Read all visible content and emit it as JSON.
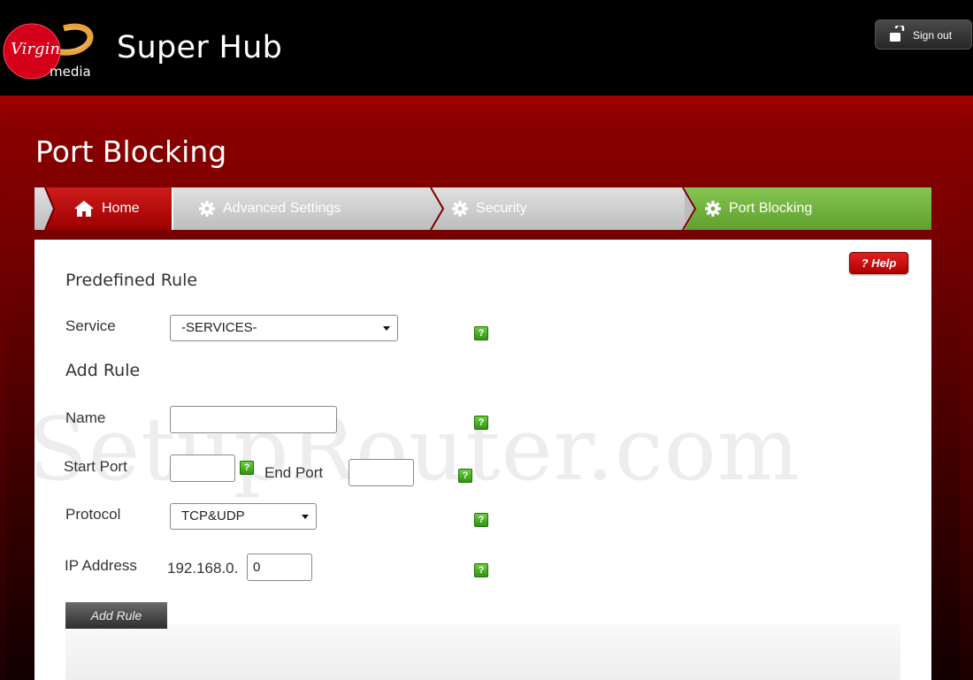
{
  "header": {
    "logo_text": "Virgin media",
    "app_title": "Super Hub",
    "signout_label": "Sign out"
  },
  "page": {
    "title": "Port Blocking",
    "help_label": "? Help"
  },
  "breadcrumb": [
    {
      "label": "Home",
      "icon": "home-icon"
    },
    {
      "label": "Advanced Settings",
      "icon": "gear-icon"
    },
    {
      "label": "Security",
      "icon": "gear-icon"
    },
    {
      "label": "Port Blocking",
      "icon": "gear-icon"
    }
  ],
  "predefined_rule": {
    "title": "Predefined Rule",
    "service_label": "Service",
    "service_value": "-SERVICES-"
  },
  "add_rule": {
    "title": "Add Rule",
    "name_label": "Name",
    "name_value": "",
    "start_port_label": "Start Port",
    "start_port_value": "",
    "end_port_label": "End Port",
    "end_port_value": "",
    "protocol_label": "Protocol",
    "protocol_value": "TCP&UDP",
    "ip_label": "IP Address",
    "ip_prefix": "192.168.0.",
    "ip_last_octet": "0",
    "button_label": "Add Rule"
  },
  "help_badge": "?",
  "watermark": "SetupRouter.com",
  "colors": {
    "brand_red": "#8a0000",
    "active_crumb": "#6cae3a",
    "home_crumb": "#b40c0c",
    "help_green": "#3aa51c"
  }
}
